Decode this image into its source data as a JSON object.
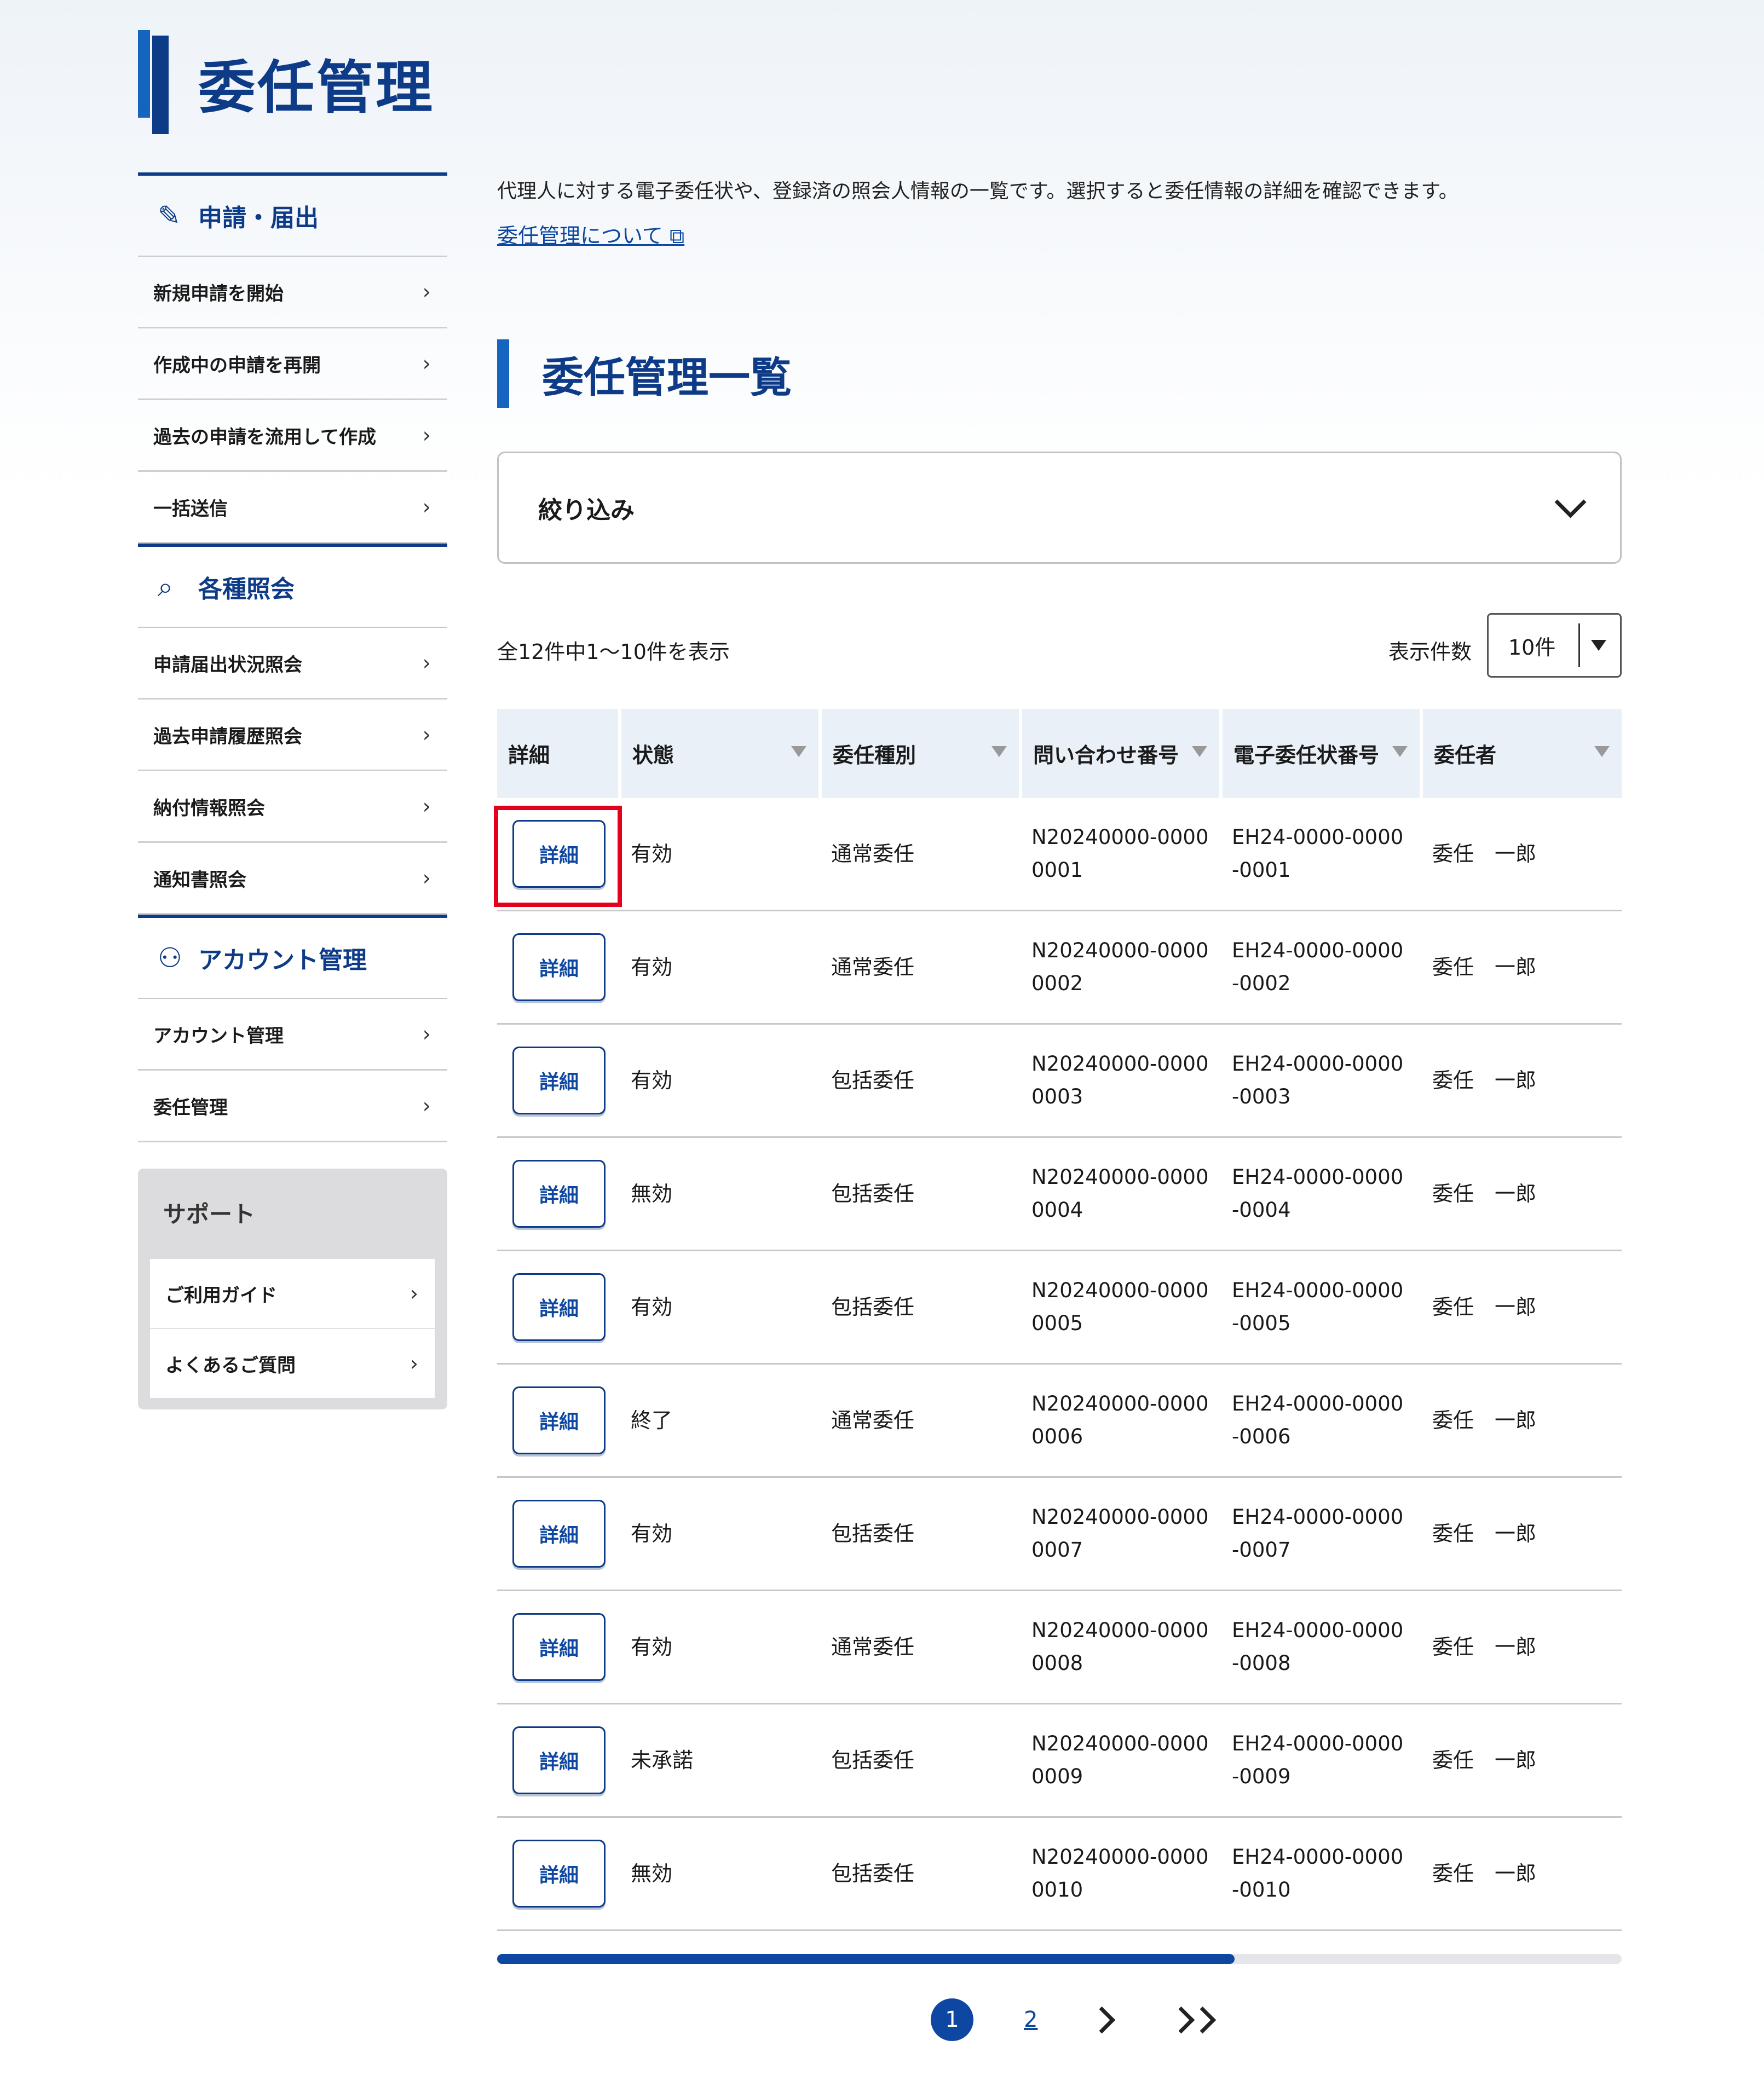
{
  "page": {
    "title": "委任管理"
  },
  "sidebar": {
    "sections": [
      {
        "heading": "申請・届出",
        "icon": "pencil-icon",
        "items": [
          "新規申請を開始",
          "作成中の申請を再開",
          "過去の申請を流用して作成",
          "一括送信"
        ]
      },
      {
        "heading": "各種照会",
        "icon": "search-document-icon",
        "items": [
          "申請届出状況照会",
          "過去申請履歴照会",
          "納付情報照会",
          "通知書照会"
        ]
      },
      {
        "heading": "アカウント管理",
        "icon": "user-settings-icon",
        "items": [
          "アカウント管理",
          "委任管理"
        ]
      }
    ],
    "support": {
      "title": "サポート",
      "items": [
        "ご利用ガイド",
        "よくあるご質問"
      ]
    }
  },
  "main": {
    "intro": "代理人に対する電子委任状や、登録済の照会人情報の一覧です。選択すると委任情報の詳細を確認できます。",
    "intro_link": "委任管理について",
    "section_title": "委任管理一覧",
    "filter_label": "絞り込み",
    "count_text": "全12件中1〜10件を表示",
    "per_page_label": "表示件数",
    "per_page_value": "10件",
    "table": {
      "headers": [
        "詳細",
        "状態",
        "委任種別",
        "問い合わせ番号",
        "電子委任状番号",
        "委任者"
      ],
      "button_label": "詳細",
      "rows": [
        {
          "status": "有効",
          "type": "通常委任",
          "inquiry": "N20240000-00000001",
          "certificate": "EH24-0000-0000-0001",
          "delegator": "委任　一郎"
        },
        {
          "status": "有効",
          "type": "通常委任",
          "inquiry": "N20240000-00000002",
          "certificate": "EH24-0000-0000-0002",
          "delegator": "委任　一郎"
        },
        {
          "status": "有効",
          "type": "包括委任",
          "inquiry": "N20240000-00000003",
          "certificate": "EH24-0000-0000-0003",
          "delegator": "委任　一郎"
        },
        {
          "status": "無効",
          "type": "包括委任",
          "inquiry": "N20240000-00000004",
          "certificate": "EH24-0000-0000-0004",
          "delegator": "委任　一郎"
        },
        {
          "status": "有効",
          "type": "包括委任",
          "inquiry": "N20240000-00000005",
          "certificate": "EH24-0000-0000-0005",
          "delegator": "委任　一郎"
        },
        {
          "status": "終了",
          "type": "通常委任",
          "inquiry": "N20240000-00000006",
          "certificate": "EH24-0000-0000-0006",
          "delegator": "委任　一郎"
        },
        {
          "status": "有効",
          "type": "包括委任",
          "inquiry": "N20240000-00000007",
          "certificate": "EH24-0000-0000-0007",
          "delegator": "委任　一郎"
        },
        {
          "status": "有効",
          "type": "通常委任",
          "inquiry": "N20240000-00000008",
          "certificate": "EH24-0000-0000-0008",
          "delegator": "委任　一郎"
        },
        {
          "status": "未承諾",
          "type": "包括委任",
          "inquiry": "N20240000-00000009",
          "certificate": "EH24-0000-0000-0009",
          "delegator": "委任　一郎"
        },
        {
          "status": "無効",
          "type": "包括委任",
          "inquiry": "N20240000-00000010",
          "certificate": "EH24-0000-0000-0010",
          "delegator": "委任　一郎"
        }
      ]
    },
    "scroll_progress": 0.656,
    "pagination": {
      "current": "1",
      "next_page": "2"
    },
    "colors": {
      "brand": "#0d3b87",
      "accent": "#1565c0",
      "highlight": "#e5001b"
    }
  }
}
